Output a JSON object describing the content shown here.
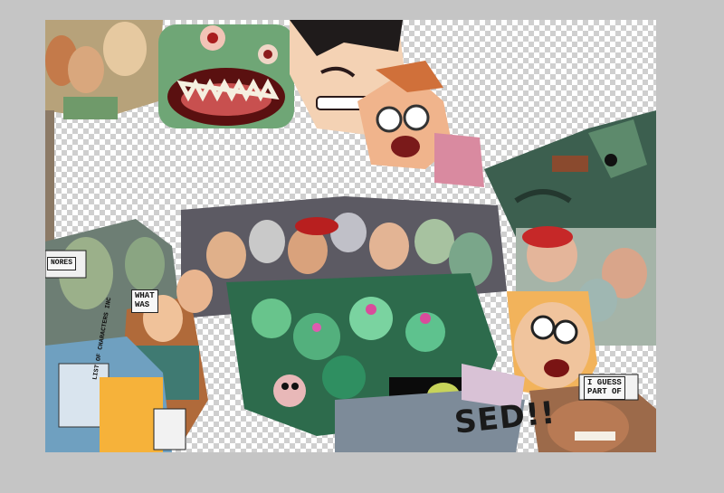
{
  "captions": {
    "what_was": "WHAT\nWAS",
    "i_guess": "I GUESS\nPART OF",
    "sfx_text": "SED!!",
    "nores": "NORES",
    "list_of_chars": "LIST OF CHARACTERS INC"
  },
  "colors": {
    "workspace": "#c5c5c5",
    "checker_light": "#ffffff",
    "checker_dark": "#cfcfcf"
  }
}
